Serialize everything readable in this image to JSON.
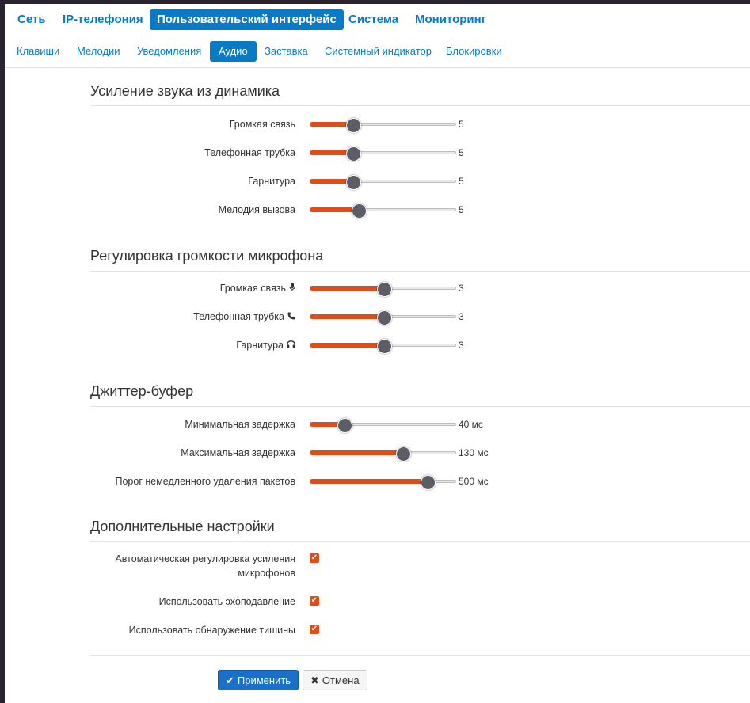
{
  "main_nav": [
    {
      "label": "Сеть",
      "active": false
    },
    {
      "label": "IP-телефония",
      "active": false
    },
    {
      "label": "Пользовательский интерфейс",
      "active": true
    },
    {
      "label": "Система",
      "active": false
    },
    {
      "label": "Мониторинг",
      "active": false
    }
  ],
  "sub_nav": [
    {
      "label": "Клавиши",
      "active": false
    },
    {
      "label": "Мелодии",
      "active": false
    },
    {
      "label": "Уведомления",
      "active": false
    },
    {
      "label": "Аудио",
      "active": true
    },
    {
      "label": "Заставка",
      "active": false
    },
    {
      "label": "Системный индикатор",
      "active": false
    },
    {
      "label": "Блокировки",
      "active": false
    }
  ],
  "speaker_gain": {
    "title": "Усиление звука из динамика",
    "items": [
      {
        "label": "Громкая связь",
        "value": "5",
        "level": 0.29
      },
      {
        "label": "Телефонная трубка",
        "value": "5",
        "level": 0.29
      },
      {
        "label": "Гарнитура",
        "value": "5",
        "level": 0.29
      },
      {
        "label": "Мелодия вызова",
        "value": "5",
        "level": 0.33
      }
    ]
  },
  "mic_volume": {
    "title": "Регулировка громкости микрофона",
    "items": [
      {
        "label": "Громкая связь",
        "icon": "microphone-icon",
        "value": "3",
        "level": 0.5
      },
      {
        "label": "Телефонная трубка",
        "icon": "phone-icon",
        "value": "3",
        "level": 0.5
      },
      {
        "label": "Гарнитура",
        "icon": "headset-icon",
        "value": "3",
        "level": 0.5
      }
    ]
  },
  "jitter": {
    "title": "Джиттер-буфер",
    "items": [
      {
        "label": "Минимальная задержка",
        "value": "40 мс",
        "level": 0.23
      },
      {
        "label": "Максимальная задержка",
        "value": "130 мс",
        "level": 0.63
      },
      {
        "label": "Порог немедленного удаления пакетов",
        "value": "500 мс",
        "level": 0.8
      }
    ]
  },
  "extra": {
    "title": "Дополнительные настройки",
    "items": [
      {
        "label_line1": "Автоматическая регулировка усиления",
        "label_line2": "микрофонов",
        "checked": true
      },
      {
        "label": "Использовать эхоподавление",
        "checked": true
      },
      {
        "label": "Использовать обнаружение тишины",
        "checked": true
      }
    ]
  },
  "buttons": {
    "apply": "Применить",
    "cancel": "Отмена"
  },
  "colors": {
    "accent": "#0a7ac4",
    "slider_fill": "#e24d17",
    "thumb": "#5d5d68"
  }
}
